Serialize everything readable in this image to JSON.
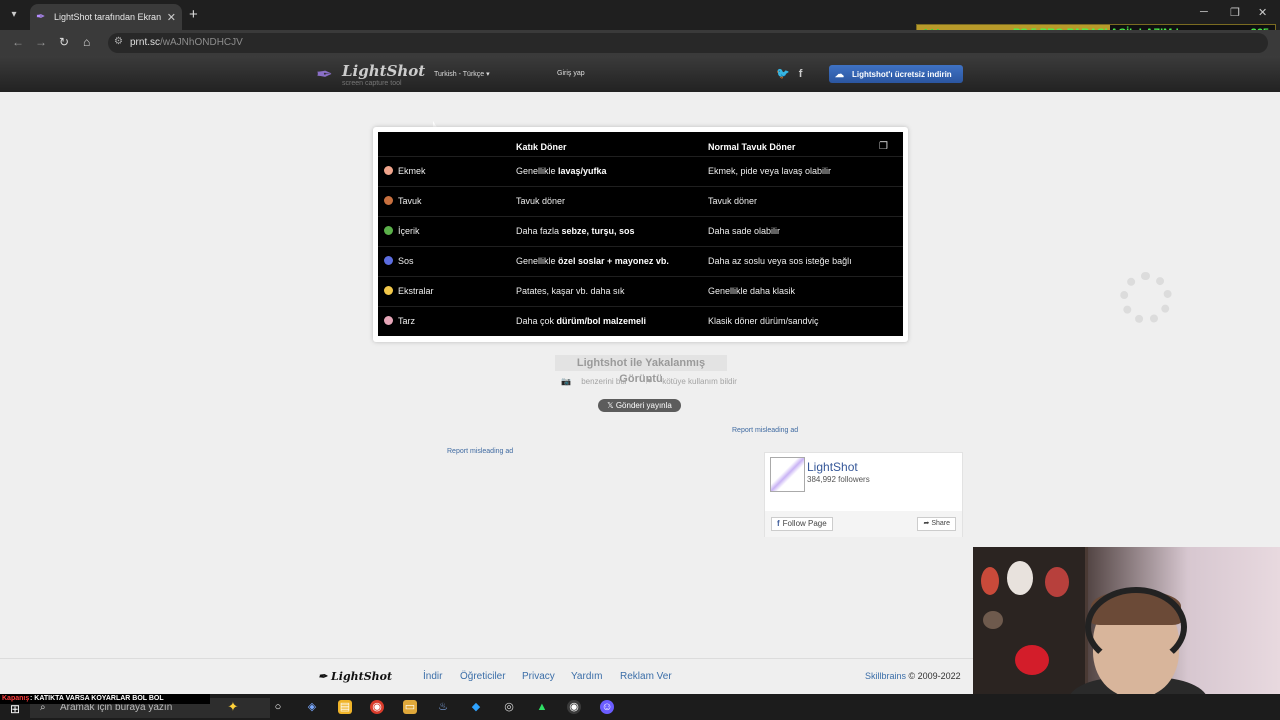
{
  "browser": {
    "tab_title": "LightShot tarafından Ekran Görüntüsü",
    "url_host": "prnt.sc",
    "url_path": "/wAJNhONDHCJV",
    "new_tab": "+",
    "close": "✕"
  },
  "overlay": {
    "left_value": "144",
    "message": "PS 5 PRO PARASI ACİL LAZIM !",
    "right_value": "265",
    "progress": 0.54
  },
  "header": {
    "logo_name": "LightShot",
    "logo_sub": "screen capture tool",
    "language": "Turkish - Türkçe",
    "login": "Giriş yap",
    "download": "Lightshot'ı ücretsiz indirin"
  },
  "table": {
    "col1": "Katık Döner",
    "col2": "Normal Tavuk Döner",
    "rows": [
      {
        "label": "Ekmek",
        "color": "#f0a58c",
        "a_plain": "Genellikle ",
        "a_bold": "lavaş/yufka",
        "a_tail": "",
        "b": "Ekmek, pide veya lavaş olabilir"
      },
      {
        "label": "Tavuk",
        "color": "#c8703f",
        "a_plain": "Tavuk döner",
        "a_bold": "",
        "a_tail": "",
        "b": "Tavuk döner"
      },
      {
        "label": "İçerik",
        "color": "#5bb04a",
        "a_plain": "Daha fazla ",
        "a_bold": "sebze, turşu, sos",
        "a_tail": "",
        "b": "Daha sade olabilir"
      },
      {
        "label": "Sos",
        "color": "#5c6de0",
        "a_plain": "Genellikle ",
        "a_bold": "özel soslar + mayonez vb.",
        "a_tail": "",
        "b": "Daha az soslu veya sos isteğe bağlı"
      },
      {
        "label": "Ekstralar",
        "color": "#f2c84a",
        "a_plain": "Patates, kaşar vb. daha sık",
        "a_bold": "",
        "a_tail": "",
        "b": "Genellikle daha klasik"
      },
      {
        "label": "Tarz",
        "color": "#e6a6b8",
        "a_plain": "Daha çok ",
        "a_bold": "dürüm/bol malzemeli",
        "a_tail": "",
        "b": "Klasik döner dürüm/sandviç"
      }
    ]
  },
  "page": {
    "caption": "Lightshot ile Yakalanmış Görüntü",
    "similar": "benzerini bul",
    "report_abuse": "kötüye kullanım bildir",
    "tweet": "Gönderi yayınla",
    "report_ad_1": "Report misleading ad",
    "report_ad_2": "Report misleading ad"
  },
  "facebook": {
    "name": "LightShot",
    "followers": "384,992 followers",
    "follow": "Follow Page",
    "share": "Share"
  },
  "footer": {
    "logo": "LightShot",
    "links": [
      "İndir",
      "Öğreticiler",
      "Privacy",
      "Yardım",
      "Reklam Ver"
    ],
    "company": "Skillbrains",
    "copyright": " © 2009-2022"
  },
  "taskbar": {
    "ticker_label": "Kapanış",
    "ticker_text": ": KATIKTA    VARSA KOYARLAR BOL BOL",
    "search_placeholder": "Aramak için buraya yazın"
  }
}
